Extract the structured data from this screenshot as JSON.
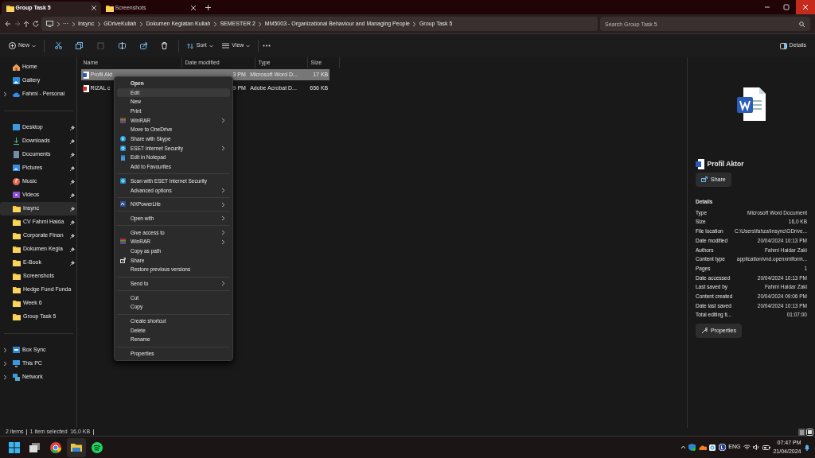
{
  "tabs": [
    {
      "label": "Group Task 5",
      "selected": true
    },
    {
      "label": "Screenshots",
      "selected": false
    }
  ],
  "address": {
    "overflow": "···",
    "crumbs": [
      "Insync",
      "GDriveKuliah",
      "Dokumen Kegiatan Kuliah",
      "SEMESTER 2",
      "MM5003 - Organizational Behaviour and Managing People",
      "Group Task 5"
    ],
    "search": {
      "placeholder": "Search Group Task 5"
    }
  },
  "command_bar": {
    "new": "New",
    "sort": "Sort",
    "view": "View",
    "details": "Details"
  },
  "sidebar": {
    "top": [
      {
        "label": "Home",
        "selected": false
      },
      {
        "label": "Gallery",
        "selected": false
      },
      {
        "label": "Fahmi - Personal",
        "selected": false,
        "expandable": true
      }
    ],
    "quick_access": [
      {
        "label": "Desktop",
        "pinned": true,
        "selected": false
      },
      {
        "label": "Downloads",
        "pinned": true,
        "selected": false
      },
      {
        "label": "Documents",
        "pinned": true,
        "selected": false
      },
      {
        "label": "Pictures",
        "pinned": true,
        "selected": false
      },
      {
        "label": "Music",
        "pinned": true,
        "selected": false
      },
      {
        "label": "Videos",
        "pinned": true,
        "selected": false
      },
      {
        "label": "Insync",
        "pinned": true,
        "selected": true
      },
      {
        "label": "CV Fahmi Haida",
        "pinned": true,
        "selected": false
      },
      {
        "label": "Corporate Finan",
        "pinned": true,
        "selected": false
      },
      {
        "label": "Dokumen Kegia",
        "pinned": true,
        "selected": false
      },
      {
        "label": "E-Book",
        "pinned": true,
        "selected": false
      },
      {
        "label": "Screenshots",
        "pinned": false,
        "selected": false
      },
      {
        "label": "Hedge Fund Funda",
        "pinned": false,
        "selected": false
      },
      {
        "label": "Week 6",
        "pinned": false,
        "selected": false
      },
      {
        "label": "Group Task 5",
        "pinned": false,
        "selected": false
      }
    ],
    "locations": [
      {
        "label": "Box Sync",
        "expandable": true
      },
      {
        "label": "This PC",
        "expandable": true
      },
      {
        "label": "Network",
        "expandable": true
      }
    ]
  },
  "file_list": {
    "columns": [
      "Name",
      "Date modified",
      "Type",
      "Size"
    ],
    "rows": [
      {
        "name": "Profil Akt",
        "date": "3 PM",
        "type": "Microsoft Word D...",
        "size": "17 KB",
        "kind": "word",
        "selected": true
      },
      {
        "name": "RIZAL c",
        "date": "9 PM",
        "type": "Adobe Acrobat D...",
        "size": "656 KB",
        "kind": "pdf",
        "selected": false
      }
    ]
  },
  "context_menu": {
    "groups": [
      [
        {
          "label": "Open",
          "default": true,
          "submenu": false,
          "selected": false
        },
        {
          "label": "Edit",
          "default": false,
          "submenu": false,
          "selected": true
        },
        {
          "label": "New",
          "default": false,
          "submenu": false,
          "selected": false
        },
        {
          "label": "Print",
          "default": false,
          "submenu": false,
          "selected": false
        },
        {
          "label": "WinRAR",
          "default": false,
          "submenu": true,
          "selected": false
        },
        {
          "label": "Move to OneDrive",
          "default": false,
          "submenu": false,
          "selected": false
        },
        {
          "label": "Share with Skype",
          "default": false,
          "submenu": false,
          "selected": false
        },
        {
          "label": "ESET Internet Security",
          "default": false,
          "submenu": true,
          "selected": false
        },
        {
          "label": "Edit in Notepad",
          "default": false,
          "submenu": false,
          "selected": false
        },
        {
          "label": "Add to Favourites",
          "default": false,
          "submenu": false,
          "selected": false
        }
      ],
      [
        {
          "label": "Scan with ESET Internet Security",
          "default": false,
          "submenu": false,
          "selected": false
        },
        {
          "label": "Advanced options",
          "default": false,
          "submenu": true,
          "selected": false
        }
      ],
      [
        {
          "label": "NXPowerLite",
          "default": false,
          "submenu": true,
          "selected": false
        }
      ],
      [
        {
          "label": "Open with",
          "default": false,
          "submenu": true,
          "selected": false
        }
      ],
      [
        {
          "label": "Give access to",
          "default": false,
          "submenu": true,
          "selected": false
        },
        {
          "label": "WinRAR",
          "default": false,
          "submenu": true,
          "selected": false
        },
        {
          "label": "Copy as path",
          "default": false,
          "submenu": false,
          "selected": false
        },
        {
          "label": "Share",
          "default": false,
          "submenu": false,
          "selected": false
        },
        {
          "label": "Restore previous versions",
          "default": false,
          "submenu": false,
          "selected": false
        }
      ],
      [
        {
          "label": "Send to",
          "default": false,
          "submenu": true,
          "selected": false
        }
      ],
      [
        {
          "label": "Cut",
          "default": false,
          "submenu": false,
          "selected": false
        },
        {
          "label": "Copy",
          "default": false,
          "submenu": false,
          "selected": false
        }
      ],
      [
        {
          "label": "Create shortcut",
          "default": false,
          "submenu": false,
          "selected": false
        },
        {
          "label": "Delete",
          "default": false,
          "submenu": false,
          "selected": false
        },
        {
          "label": "Rename",
          "default": false,
          "submenu": false,
          "selected": false
        }
      ],
      [
        {
          "label": "Properties",
          "default": false,
          "submenu": false,
          "selected": false
        }
      ]
    ]
  },
  "details_pane": {
    "file_name": "Profil Aktor",
    "share": "Share",
    "heading": "Details",
    "properties": [
      {
        "label": "Type",
        "value": "Microsoft Word Document"
      },
      {
        "label": "Size",
        "value": "16,0 KB"
      },
      {
        "label": "File location",
        "value": "C:\\Users\\fahza\\Insync\\GDrive..."
      },
      {
        "label": "Date modified",
        "value": "20/04/2024 10:13 PM"
      },
      {
        "label": "Authors",
        "value": "Fahmi Haidar Zaki"
      },
      {
        "label": "Content type",
        "value": "application/vnd.openxmlform..."
      },
      {
        "label": "Pages",
        "value": "1"
      },
      {
        "label": "Date accessed",
        "value": "20/04/2024 10:13 PM"
      },
      {
        "label": "Last saved by",
        "value": "Fahmi Haidar Zaki"
      },
      {
        "label": "Content created",
        "value": "20/04/2024 09:06 PM"
      },
      {
        "label": "Date last saved",
        "value": "20/04/2024 10:13 PM"
      },
      {
        "label": "Total editing ti...",
        "value": "01:07:00"
      }
    ],
    "properties_button": "Properties"
  },
  "status_bar": [
    "2 items",
    "1 item selected",
    "16,0 KB"
  ],
  "taskbar": {
    "language": "ENG",
    "time": "07:47 PM",
    "date": "21/04/2024"
  }
}
